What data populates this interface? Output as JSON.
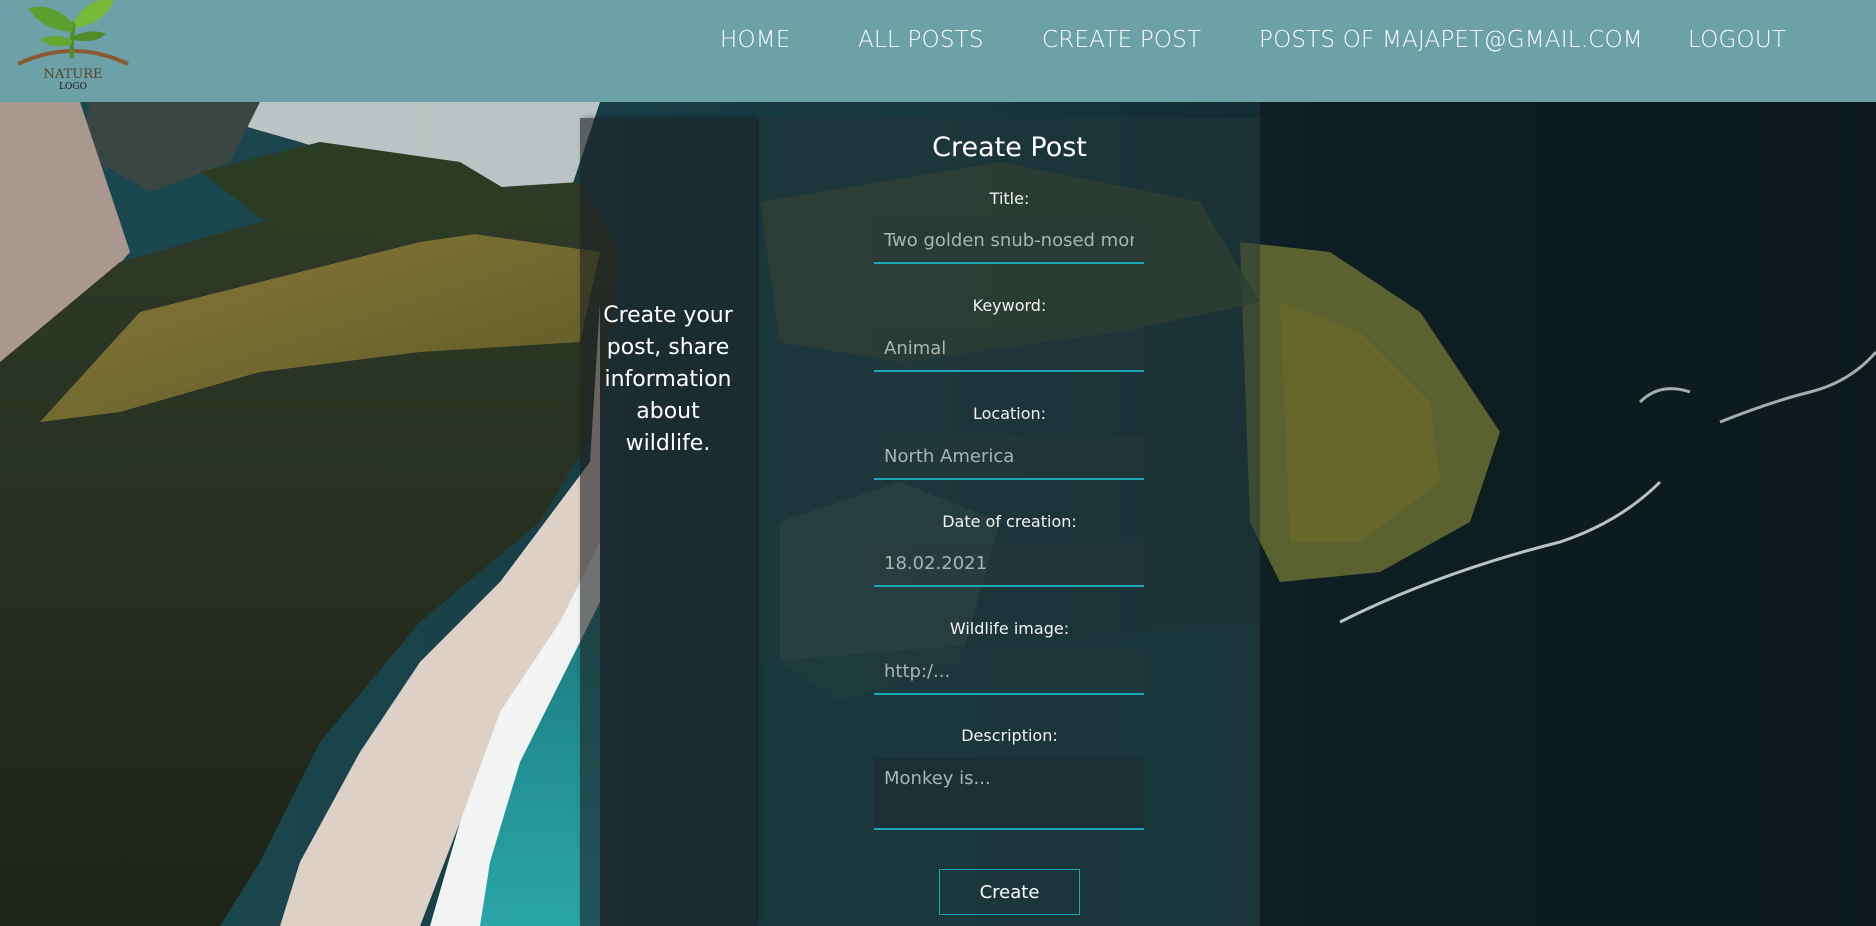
{
  "logo": {
    "line1": "NATURE",
    "line2": "LOGO",
    "icon": "sprout-icon"
  },
  "nav": {
    "items": [
      {
        "label": "HOME"
      },
      {
        "label": "ALL POSTS"
      },
      {
        "label": "CREATE POST"
      },
      {
        "label": "POSTS OF MAJAPET@GMAIL.COM"
      },
      {
        "label": "LOGOUT"
      }
    ]
  },
  "side_panel": {
    "text": "Create your post, share information about wildlife."
  },
  "form": {
    "title": "Create Post",
    "fields": [
      {
        "label": "Title:",
        "value": "",
        "placeholder": "Two golden snub-nosed mon"
      },
      {
        "label": "Keyword:",
        "value": "",
        "placeholder": "Animal"
      },
      {
        "label": "Location:",
        "value": "",
        "placeholder": "North America"
      },
      {
        "label": "Date of creation:",
        "value": "",
        "placeholder": "18.02.2021"
      },
      {
        "label": "Wildlife image:",
        "value": "",
        "placeholder": "http:/..."
      },
      {
        "label": "Description:",
        "value": "",
        "placeholder": "Monkey is..."
      }
    ],
    "submit_label": "Create"
  },
  "colors": {
    "header_bg": "#6ba1a7",
    "accent": "#1aa7b2",
    "text": "#ffffff"
  }
}
